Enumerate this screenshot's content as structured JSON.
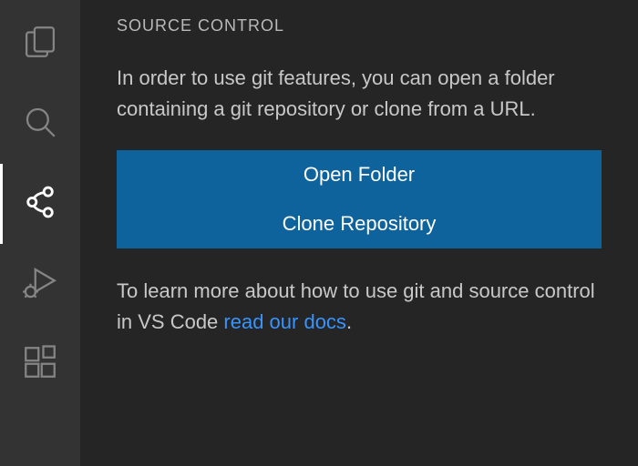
{
  "activityBar": {
    "items": [
      {
        "name": "explorer-icon",
        "active": false
      },
      {
        "name": "search-icon",
        "active": false
      },
      {
        "name": "source-control-icon",
        "active": true
      },
      {
        "name": "run-debug-icon",
        "active": false
      },
      {
        "name": "extensions-icon",
        "active": false
      }
    ]
  },
  "panel": {
    "title": "SOURCE CONTROL",
    "description": "In order to use git features, you can open a folder containing a git repository or clone from a URL.",
    "buttons": {
      "openFolder": "Open Folder",
      "cloneRepo": "Clone Repository"
    },
    "learn": {
      "prefix": "To learn more about how to use git and source control in VS Code ",
      "linkText": "read our docs",
      "suffix": "."
    }
  }
}
